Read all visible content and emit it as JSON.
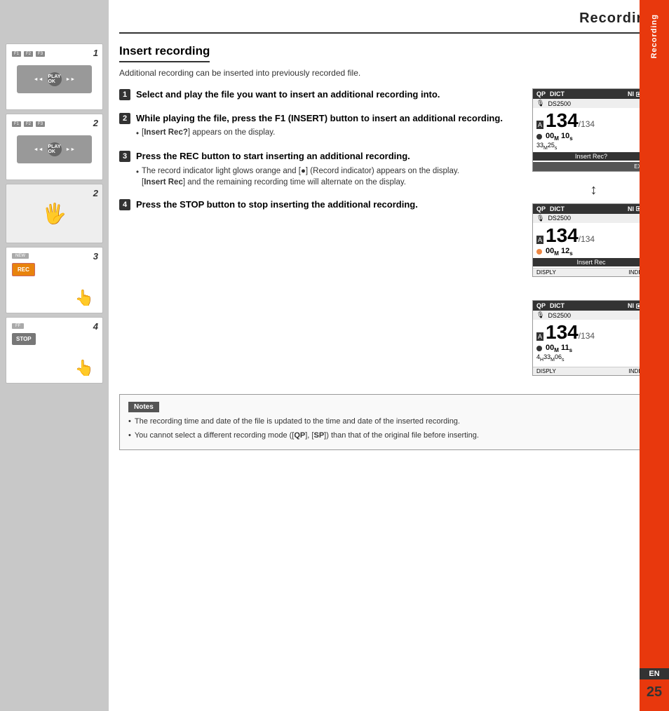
{
  "page": {
    "title": "Recording",
    "page_number": "25",
    "en_label": "EN",
    "section_title": "Insert recording",
    "subtitle": "Additional recording can be inserted into previously recorded file."
  },
  "sidebar": {
    "label": "Recording",
    "illustrations": [
      {
        "number": "1",
        "buttons": [
          "F1",
          "F2",
          "F3"
        ],
        "type": "playok"
      },
      {
        "number": "2",
        "buttons": [
          "F1",
          "F2",
          "F3"
        ],
        "type": "playok"
      },
      {
        "number": "2",
        "type": "fingers"
      },
      {
        "number": "3",
        "type": "rec"
      },
      {
        "number": "4",
        "type": "stop"
      }
    ]
  },
  "steps": [
    {
      "number": "1",
      "heading": "Select and play the file you want to insert an additional recording into."
    },
    {
      "number": "2",
      "heading": "While playing the file, press the F1 (INSERT) button to insert an additional recording.",
      "bullets": [
        "[Insert Rec?] appears on the display."
      ]
    },
    {
      "number": "3",
      "heading": "Press the REC button to start inserting an additional recording.",
      "bullets": [
        "The record indicator light glows orange and [●] (Record indicator) appears on the display.",
        "[Insert Rec] and the remaining recording time will alternate on the display."
      ]
    },
    {
      "number": "4",
      "heading": "Press the STOP button to stop inserting the additional recording."
    }
  ],
  "screens": [
    {
      "id": "screen1",
      "header_left": [
        "QP",
        "DICT"
      ],
      "header_right": "NI",
      "subheader": "DS2500",
      "row_letter": "A",
      "big_number": "134",
      "slash_number": "134",
      "time_top": "00M 10s",
      "time_bottom": "33M 25s",
      "label_bar": "Insert Rec?",
      "exit_btn": "EXIT"
    },
    {
      "id": "screen2",
      "header_left": [
        "QP",
        "DICT"
      ],
      "header_right": "NI",
      "subheader": "DS2500",
      "row_letter": "A",
      "big_number": "134",
      "slash_number": "134",
      "time_top": "00M 12s",
      "label_bar": "Insert Rec",
      "bottom_left": "DISPLY",
      "bottom_right": "INDEX"
    },
    {
      "id": "screen3",
      "header_left": [
        "QP",
        "DICT"
      ],
      "header_right": "NI",
      "subheader": "DS2500",
      "row_letter": "A",
      "big_number": "134",
      "slash_number": "134",
      "time_top": "00M 11s",
      "time_bottom": "4H 33M 06s",
      "label_bar": "",
      "bottom_left": "DISPLY",
      "bottom_right": "INDEX"
    }
  ],
  "notes": {
    "title": "Notes",
    "items": [
      "The recording time and date of the file is updated to the time and date of the inserted recording.",
      "You cannot select a different recording mode ([QP], [SP]) than that of the original file before inserting."
    ]
  }
}
